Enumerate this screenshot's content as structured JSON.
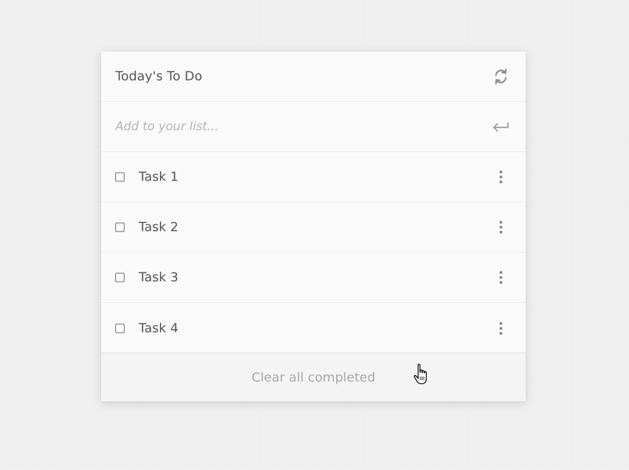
{
  "header": {
    "title": "Today's To Do",
    "refresh_icon": "refresh-icon"
  },
  "add_input": {
    "placeholder": "Add to your list...",
    "value": "",
    "submit_icon": "enter-return-icon"
  },
  "tasks": [
    {
      "label": "Task 1",
      "checked": false,
      "menu_icon": "more-vertical-icon"
    },
    {
      "label": "Task 2",
      "checked": false,
      "menu_icon": "more-vertical-icon"
    },
    {
      "label": "Task 3",
      "checked": false,
      "menu_icon": "more-vertical-icon"
    },
    {
      "label": "Task 4",
      "checked": false,
      "menu_icon": "more-vertical-icon"
    }
  ],
  "footer": {
    "clear_label": "Clear all completed"
  },
  "colors": {
    "background": "#f1f1f1",
    "card": "#fafafa",
    "text": "#555555",
    "muted": "#a8a8a8",
    "divider": "#ececec"
  }
}
